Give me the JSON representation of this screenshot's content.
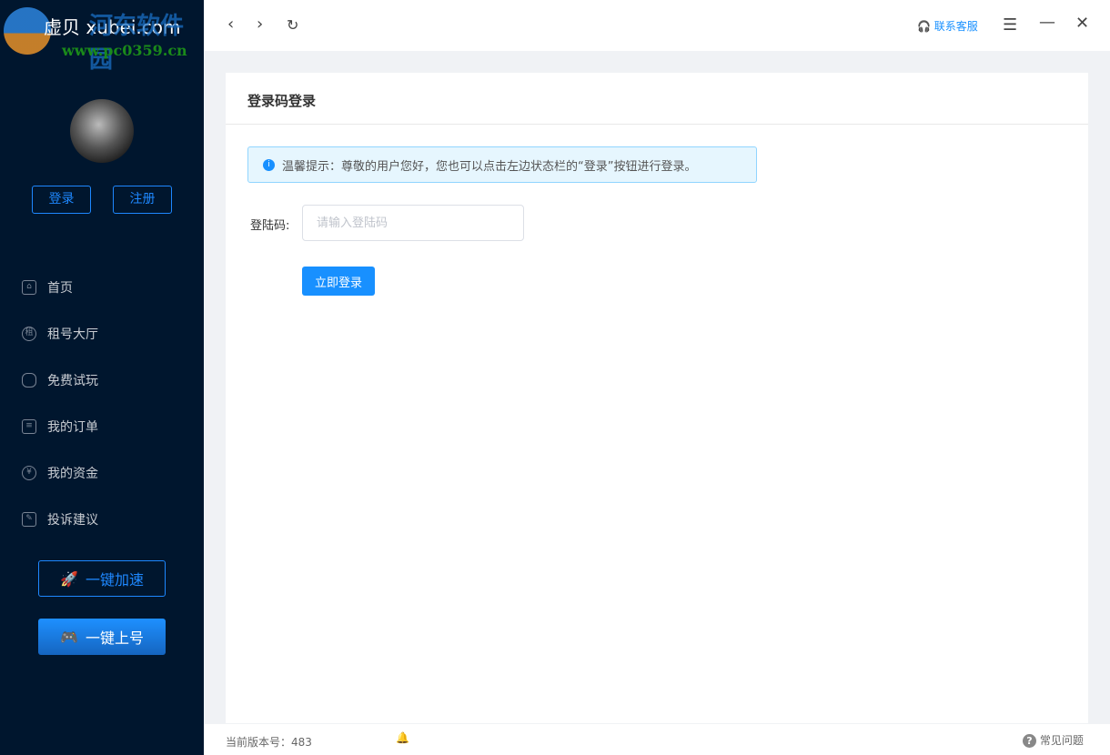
{
  "app": {
    "title": "虚贝 xubei.com",
    "watermark": "河东软件园",
    "watermark_url": "www.pc0359.cn"
  },
  "sidebar": {
    "login": "登录",
    "register": "注册",
    "items": [
      {
        "label": "首页",
        "icon": "home-icon"
      },
      {
        "label": "租号大厅",
        "icon": "rent-icon",
        "glyph": "租"
      },
      {
        "label": "免费试玩",
        "icon": "gamepad-icon"
      },
      {
        "label": "我的订单",
        "icon": "order-icon"
      },
      {
        "label": "我的资金",
        "icon": "money-bag-icon",
        "glyph": "¥"
      },
      {
        "label": "投诉建议",
        "icon": "edit-icon"
      }
    ],
    "speed_label": "一键加速",
    "up_label": "一键上号"
  },
  "topbar": {
    "support": "联系客服"
  },
  "main": {
    "title": "登录码登录",
    "tip": "温馨提示：尊敬的用户您好，您也可以点击左边状态栏的“登录”按钮进行登录。",
    "field_label": "登陆码:",
    "placeholder": "请输入登陆码",
    "submit": "立即登录"
  },
  "footer": {
    "version": "当前版本号：483",
    "faq": "常见问题"
  },
  "colors": {
    "sidebar": "#00162e",
    "accent": "#1890ff"
  }
}
